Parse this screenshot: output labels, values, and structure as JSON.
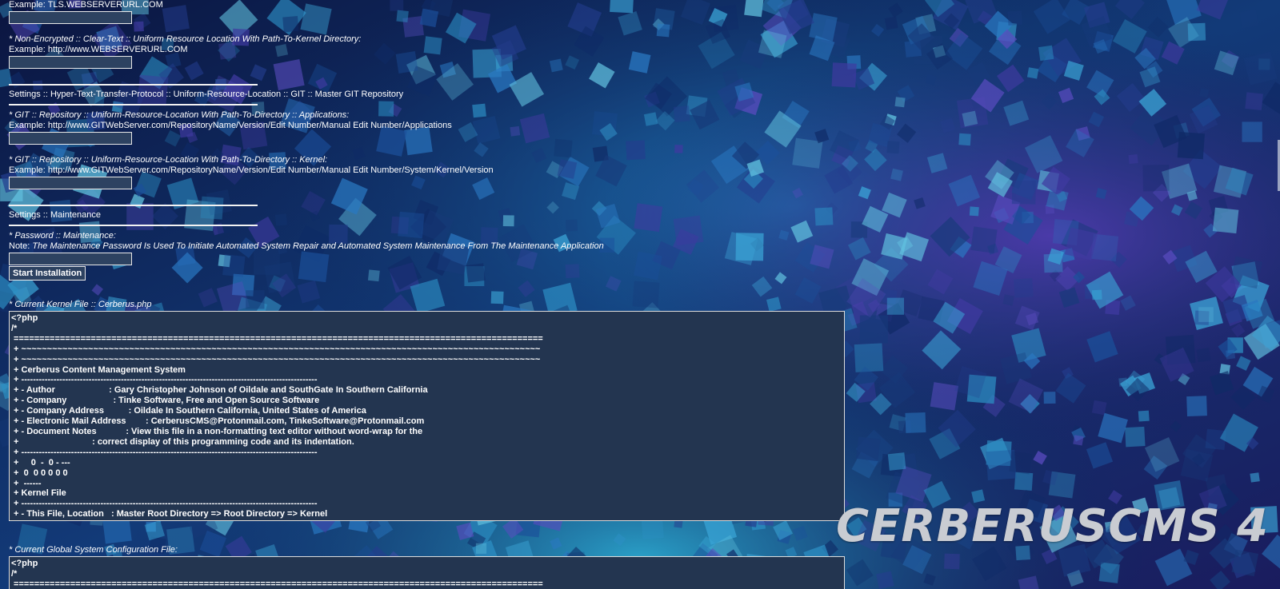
{
  "sections": {
    "tls_example": "Example: TLS.WEBSERVERURL.COM",
    "nonencrypted_label": "* Non-Encrypted :: Clear-Text :: Uniform Resource Location With Path-To-Kernel Directory:",
    "nonencrypted_example": "Example: http://www.WEBSERVERURL.COM",
    "git_heading": "Settings :: Hyper-Text-Transfer-Protocol :: Uniform-Resource-Location :: GIT :: Master GIT Repository",
    "git_apps_label": "* GIT :: Repository :: Uniform-Resource-Location With Path-To-Directory :: Applications:",
    "git_apps_example": "Example: http://www.GITWebServer.com/RepositoryName/Version/Edit Number/Manual Edit Number/Applications",
    "git_kernel_label": "* GIT :: Repository :: Uniform-Resource-Location With Path-To-Directory :: Kernel:",
    "git_kernel_example": "Example: http://www.GITWebServer.com/RepositoryName/Version/Edit Number/Manual Edit Number/System/Kernel/Version",
    "maint_heading": "Settings :: Maintenance",
    "maint_password_label": "* Password :: Maintenance:",
    "maint_note_prefix": "Note: ",
    "maint_note_text": "The Maintenance Password Is Used To Initiate Automated System Repair and Automated System Maintenance From The Maintenance Application",
    "start_button": "Start Installation",
    "kernel_file_label": "* Current Kernel File :: Cerberus.php",
    "global_config_label": "* Current Global System Configuration File:"
  },
  "fields": {
    "tls_url": "",
    "nonencrypted_url": "",
    "git_apps_url": "",
    "git_kernel_url": "",
    "maint_password": ""
  },
  "kernel_code": "<?php\n/*\n =======================================================================================================\n + ~~~~~~~~~~~~~~~~~~~~~~~~~~~~~~~~~~~~~~~~~~~~~~~~~~~~~~~~~~~~~~~~~~~~~~~~~~~~~~~~~~~~~~~~~~~~~~~~~~~~~\n + ~~~~~~~~~~~~~~~~~~~~~~~~~~~~~~~~~~~~~~~~~~~~~~~~~~~~~~~~~~~~~~~~~~~~~~~~~~~~~~~~~~~~~~~~~~~~~~~~~~~~~\n + Cerberus Content Management System\n + -----------------------------------------------------------------------------------------------------\n + - Author                      : Gary Christopher Johnson of Oildale and SouthGate In Southern California\n + - Company                   : Tinke Software, Free and Open Source Software\n + - Company Address          : Oildale In Southern California, United States of America\n + - Electronic Mail Address        : CerberusCMS@Protonmail.com, TinkeSoftware@Protonmail.com\n + - Document Notes            : View this file in a non-formatting text editor without word-wrap for the\n +                              : correct display of this programming code and its indentation.\n + -----------------------------------------------------------------------------------------------------\n +     0  -  0 - ---\n +  0  0 0 0 0 0\n +  ------\n + Kernel File\n + -----------------------------------------------------------------------------------------------------\n + - This File, Location   : Master Root Directory => Root Directory => Kernel",
  "config_code": "<?php\n/*\n =======================================================================================================",
  "brand": "CERBERUSCMS 4",
  "colors": {
    "field_bg": "#2d4261",
    "code_bg": "#233550",
    "text": "#ffffff",
    "brand_text": "#c9ccd2"
  }
}
